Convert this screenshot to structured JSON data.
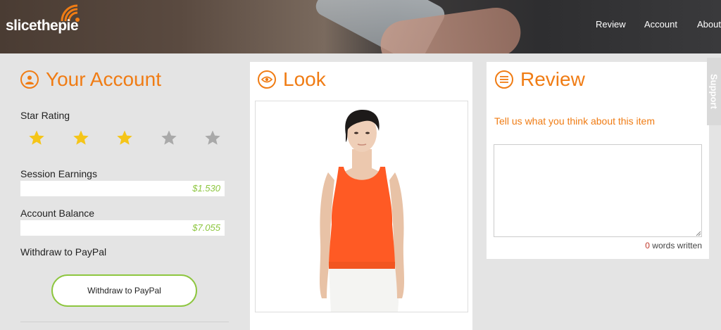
{
  "header": {
    "logo_text": "slicethepie",
    "nav": [
      {
        "label": "Review"
      },
      {
        "label": "Account"
      },
      {
        "label": "About"
      }
    ]
  },
  "account": {
    "title": "Your Account",
    "star_rating_label": "Star Rating",
    "stars": {
      "filled": 3,
      "total": 5
    },
    "session_earnings_label": "Session Earnings",
    "session_earnings_value": "$1.530",
    "account_balance_label": "Account Balance",
    "account_balance_value": "$7.055",
    "withdraw_label": "Withdraw to PayPal",
    "withdraw_button": "Withdraw to PayPal"
  },
  "look": {
    "title": "Look"
  },
  "review": {
    "title": "Review",
    "prompt": "Tell us what you think about this item",
    "textarea_value": "",
    "words_count": "0",
    "words_suffix": " words written"
  },
  "support": {
    "label": "Support"
  },
  "colors": {
    "accent": "#f07c14",
    "earnings": "#8dc63f",
    "star_filled": "#f5c518",
    "star_empty": "#a9a9a9",
    "product_top": "#ff5a24"
  }
}
